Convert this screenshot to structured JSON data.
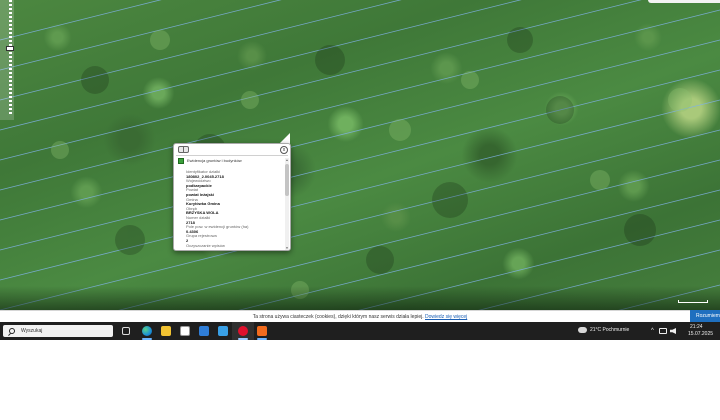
{
  "popup": {
    "layer_name": "Ewidencja gruntów i budynków",
    "close_symbol": "x",
    "fields": [
      {
        "label": "Identyfikator działki",
        "value": "180802_2.0045.2718"
      },
      {
        "label": "Województwo",
        "value": "podkarpackie"
      },
      {
        "label": "Powiat",
        "value": "powiat leżajski"
      },
      {
        "label": "Gmina",
        "value": "Kuryłówka Gmina"
      },
      {
        "label": "Obręb",
        "value": "BRZYSKA WOLA"
      },
      {
        "label": "Numer działki",
        "value": "2718"
      },
      {
        "label": "Pole pow. w ewidencji gruntów (ha)",
        "value": "0.4306"
      },
      {
        "label": "Grupa rejestrowa",
        "value": "2"
      },
      {
        "label": "Data publikacji",
        "value": ""
      }
    ],
    "truncated_label": "Oczyszczanie wpisów"
  },
  "cookie_bar": {
    "text": "Ta strona używa ciasteczek (cookies), dzięki którym nasz serwis działa lepiej.",
    "link": "Dowiedz się więcej",
    "button": "Rozumiem"
  },
  "taskbar": {
    "search_placeholder": "Wyszukaj",
    "weather": "21°C  Pochmurnie",
    "time": "21:24",
    "date": "15.07.2025",
    "tray_chevron": "^"
  },
  "icons": [
    "search-icon",
    "task-view-icon",
    "edge-icon",
    "file-explorer-icon",
    "calendar-icon",
    "store-icon",
    "photos-icon",
    "opera-icon",
    "app-orange-icon",
    "weather-icon",
    "network-icon",
    "volume-icon"
  ]
}
